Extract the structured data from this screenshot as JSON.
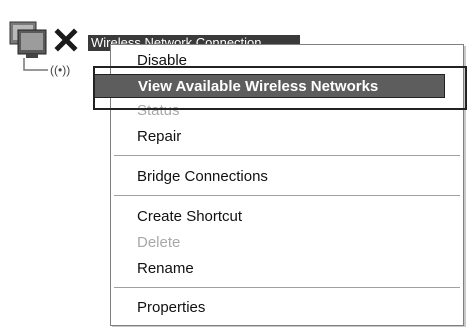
{
  "desktop_icon": {
    "label": "Wireless Network Connection",
    "icon": "wireless-network-disconnected-icon"
  },
  "context_menu": {
    "items": [
      {
        "label": "Disable",
        "state": "normal"
      },
      {
        "label": "View Available Wireless Networks",
        "state": "highlighted"
      },
      {
        "label": "Status",
        "state": "disabled"
      },
      {
        "label": "Repair",
        "state": "normal"
      },
      {
        "label": "Bridge Connections",
        "state": "normal"
      },
      {
        "label": "Create Shortcut",
        "state": "normal"
      },
      {
        "label": "Delete",
        "state": "disabled"
      },
      {
        "label": "Rename",
        "state": "normal"
      },
      {
        "label": "Properties",
        "state": "normal"
      }
    ]
  },
  "colors": {
    "highlight_bg": "#5d5d5d",
    "disabled_text": "#a8a8a8",
    "callout_border": "#222222"
  }
}
